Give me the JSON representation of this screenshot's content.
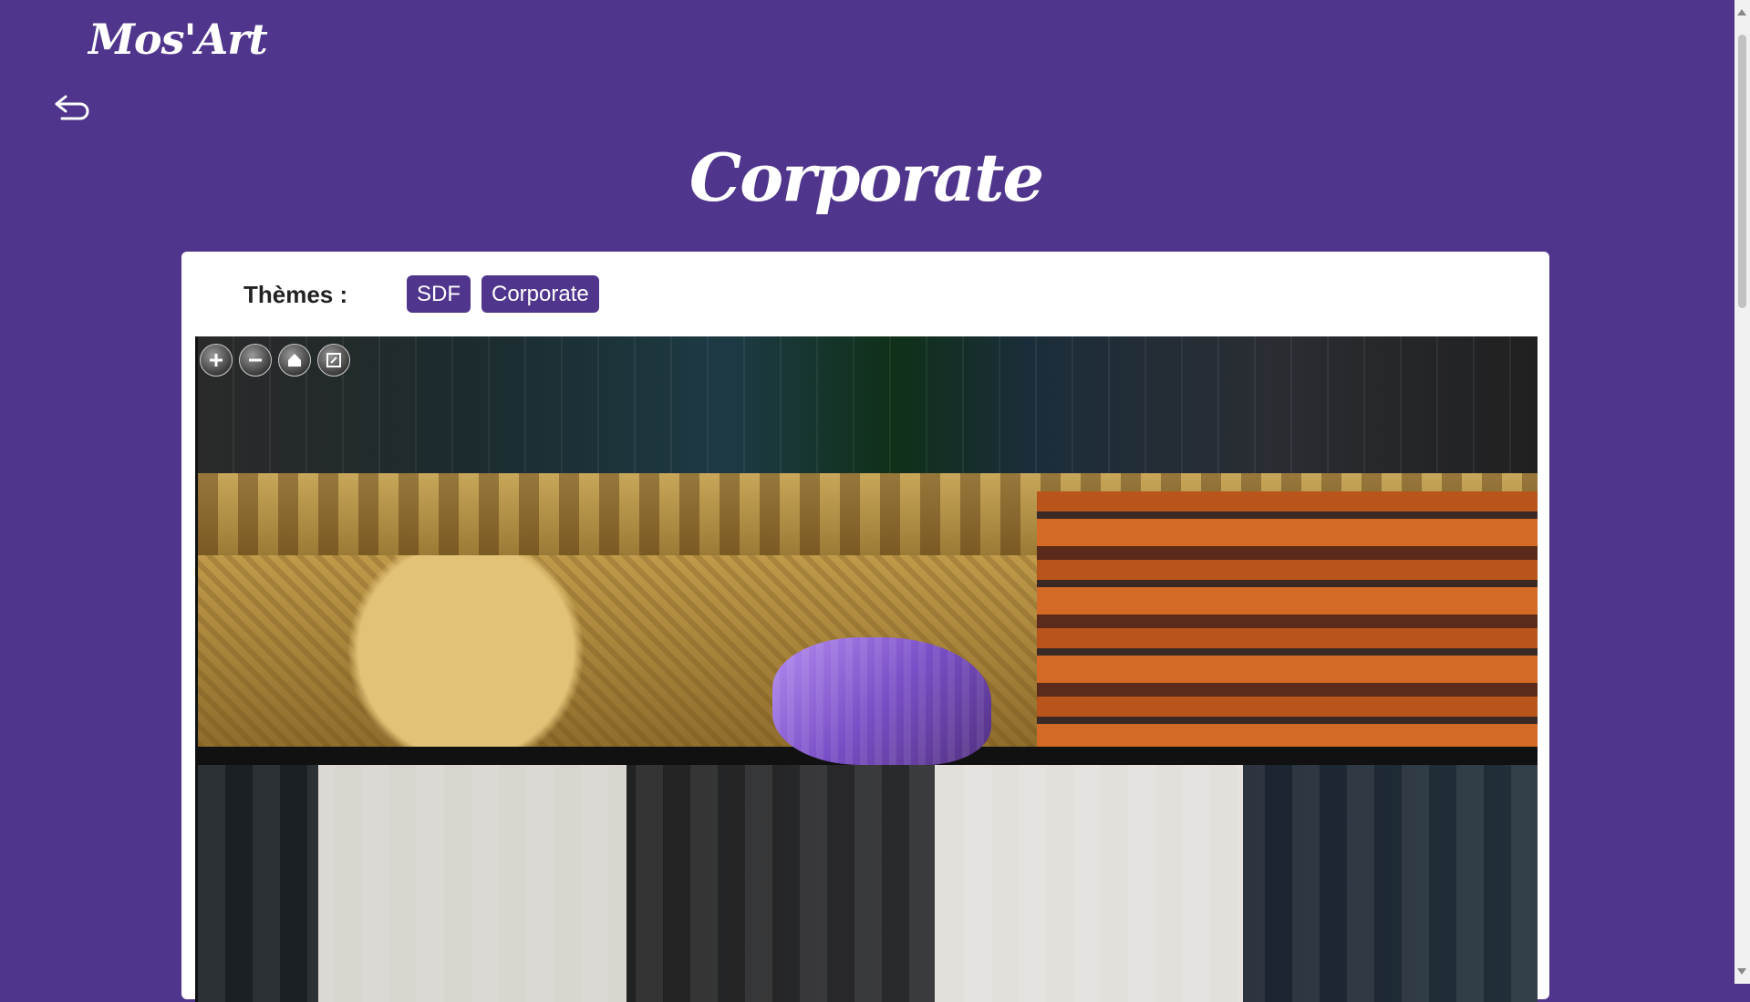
{
  "header": {
    "logo_text": "Mos'Art"
  },
  "nav": {
    "back_icon": "undo-arrow-icon"
  },
  "page": {
    "title": "Corporate"
  },
  "themes": {
    "label": "Thèmes :",
    "tags": [
      "SDF",
      "Corporate"
    ]
  },
  "viewer": {
    "controls": [
      "zoom-in-icon",
      "zoom-out-icon",
      "home-icon",
      "fullscreen-icon"
    ],
    "image_description": "photo mosaic"
  },
  "colors": {
    "accent": "#4f358c",
    "card": "#ffffff"
  }
}
